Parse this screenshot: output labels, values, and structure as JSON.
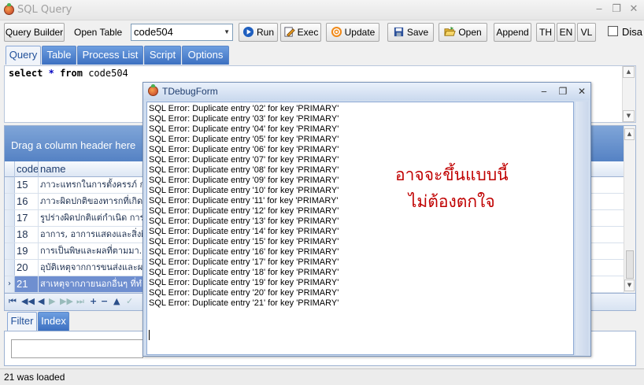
{
  "window": {
    "title": "SQL Query",
    "buttons": [
      "‒",
      "❐",
      "✕"
    ]
  },
  "toolbar": {
    "query_builder": "Query Builder",
    "open_table_label": "Open Table",
    "table_combo_value": "code504",
    "run": "Run",
    "exec": "Exec",
    "update": "Update",
    "save": "Save",
    "open": "Open",
    "append": "Append",
    "lang_th": "TH",
    "lang_en": "EN",
    "lang_vl": "VL",
    "disable_label": "Disa"
  },
  "tabs": [
    "Query",
    "Table",
    "Process List",
    "Script",
    "Options"
  ],
  "editor": {
    "keyword1": "select",
    "star": "*",
    "keyword2": "from",
    "table": "code504"
  },
  "grid": {
    "group_hint": "Drag a column header here",
    "columns": [
      "code",
      "name"
    ],
    "rows": [
      {
        "code": "15",
        "name": "ภาวะแทรกในการตั้งครรภ์ การ"
      },
      {
        "code": "16",
        "name": "ภาวะผิดปกติของทารกที่เกิดขึ้น"
      },
      {
        "code": "17",
        "name": "รูปร่างผิดปกติแต่กำเนิด การ"
      },
      {
        "code": "18",
        "name": "อาการ, อาการแสดงและสิ่งผิด"
      },
      {
        "code": "19",
        "name": "การเป็นพิษและผลที่ตามมา..."
      },
      {
        "code": "20",
        "name": "อุบัติเหตุจากการขนส่งและผล"
      },
      {
        "code": "21",
        "name": "สาเหตุจากภายนอกอื่นๆ ที่ทำ"
      }
    ],
    "selected_indicator": "›"
  },
  "lower_tabs": [
    "Filter",
    "Index"
  ],
  "status": {
    "text": "21 was loaded"
  },
  "dialog": {
    "title": "TDebugForm",
    "buttons": [
      "‒",
      "❐",
      "✕"
    ],
    "log": [
      "SQL Error: Duplicate entry '02' for key 'PRIMARY'",
      "SQL Error: Duplicate entry '03' for key 'PRIMARY'",
      "SQL Error: Duplicate entry '04' for key 'PRIMARY'",
      "SQL Error: Duplicate entry '05' for key 'PRIMARY'",
      "SQL Error: Duplicate entry '06' for key 'PRIMARY'",
      "SQL Error: Duplicate entry '07' for key 'PRIMARY'",
      "SQL Error: Duplicate entry '08' for key 'PRIMARY'",
      "SQL Error: Duplicate entry '09' for key 'PRIMARY'",
      "SQL Error: Duplicate entry '10' for key 'PRIMARY'",
      "SQL Error: Duplicate entry '11' for key 'PRIMARY'",
      "SQL Error: Duplicate entry '12' for key 'PRIMARY'",
      "SQL Error: Duplicate entry '13' for key 'PRIMARY'",
      "SQL Error: Duplicate entry '14' for key 'PRIMARY'",
      "SQL Error: Duplicate entry '15' for key 'PRIMARY'",
      "SQL Error: Duplicate entry '16' for key 'PRIMARY'",
      "SQL Error: Duplicate entry '17' for key 'PRIMARY'",
      "SQL Error: Duplicate entry '18' for key 'PRIMARY'",
      "SQL Error: Duplicate entry '19' for key 'PRIMARY'",
      "SQL Error: Duplicate entry '20' for key 'PRIMARY'",
      "SQL Error: Duplicate entry '21' for key 'PRIMARY'"
    ],
    "note_line1": "อาจจะขึ้นแบบนี้",
    "note_line2": "ไม่ต้องตกใจ"
  },
  "colors": {
    "accent": "#3c70c1",
    "note": "#c00000",
    "selection": "#6f8fd0"
  }
}
